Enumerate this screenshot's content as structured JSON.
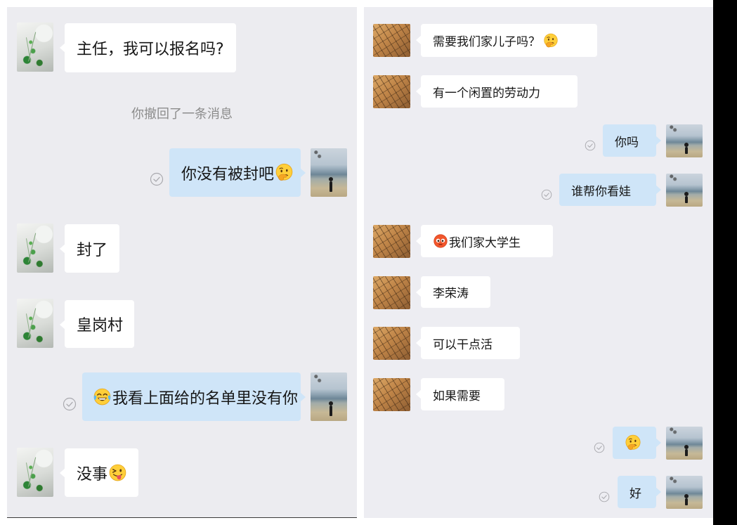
{
  "theme": {
    "panel_bg": "#ececf0",
    "sent_bubble": "#cfe5f8",
    "received_bubble": "#ffffff",
    "text": "#161616",
    "system_text": "#8c8c8c"
  },
  "avatars": {
    "left_contact": "plant-avatar",
    "right_contact": "branch-avatar",
    "self": "beach-silhouette-avatar"
  },
  "left_panel": {
    "system_notice": "你撤回了一条消息",
    "messages": [
      {
        "text": "主任，我可以报名吗?"
      },
      {
        "text": "你没有被封吧",
        "emoji": "thinking-face-icon",
        "status": "read-check-icon"
      },
      {
        "text": "封了"
      },
      {
        "text": "皇岗村"
      },
      {
        "text": "我看上面给的名单里没有你",
        "emoji": "tears-of-joy-icon",
        "status": "read-check-icon"
      },
      {
        "text": "没事",
        "emoji": "winking-tongue-face-icon"
      }
    ]
  },
  "right_panel": {
    "messages": [
      {
        "text": "需要我们家儿子吗？",
        "emoji": "thinking-face-icon"
      },
      {
        "text": "有一个闲置的劳动力"
      },
      {
        "text": "你吗",
        "status": "read-check-icon"
      },
      {
        "text": "谁帮你看娃",
        "status": "read-check-icon"
      },
      {
        "text": "我们家大学生",
        "emoji": "flushed-face-icon"
      },
      {
        "text": "李荣涛"
      },
      {
        "text": "可以干点活"
      },
      {
        "text": "如果需要"
      },
      {
        "emoji": "thinking-face-icon",
        "status": "read-check-icon"
      },
      {
        "text": "好",
        "status": "read-check-icon"
      }
    ]
  }
}
